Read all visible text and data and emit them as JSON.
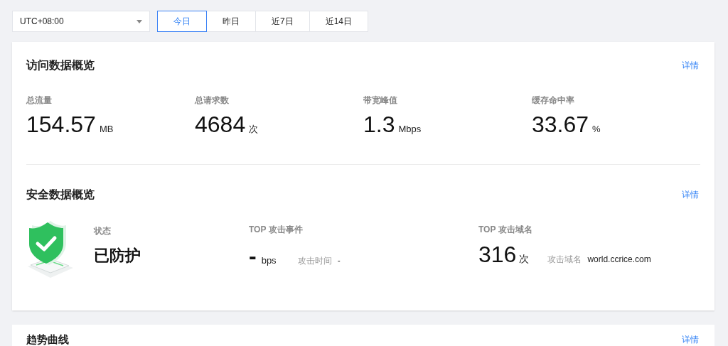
{
  "timezone_select": {
    "value": "UTC+08:00"
  },
  "range_tabs": [
    {
      "label": "今日",
      "selected": true
    },
    {
      "label": "昨日",
      "selected": false
    },
    {
      "label": "近7日",
      "selected": false
    },
    {
      "label": "近14日",
      "selected": false
    }
  ],
  "access_overview": {
    "title": "访问数据概览",
    "details_link": "详情",
    "metrics": [
      {
        "label": "总流量",
        "value": "154.57",
        "unit": "MB"
      },
      {
        "label": "总请求数",
        "value": "4684",
        "unit": "次"
      },
      {
        "label": "带宽峰值",
        "value": "1.3",
        "unit": "Mbps"
      },
      {
        "label": "缓存命中率",
        "value": "33.67",
        "unit": "%"
      }
    ]
  },
  "security_overview": {
    "title": "安全数据概览",
    "details_link": "详情",
    "status": {
      "label": "状态",
      "value": "已防护"
    },
    "top_attack_event": {
      "label": "TOP 攻击事件",
      "value": "-",
      "unit": "bps",
      "time_label": "攻击时间",
      "time_value": "-"
    },
    "top_attack_domain": {
      "label": "TOP 攻击域名",
      "value": "316",
      "unit": "次",
      "domain_label": "攻击域名",
      "domain_value": "world.ccrice.com"
    }
  },
  "trend_card": {
    "title": "趋势曲线",
    "details_link": "详情"
  }
}
